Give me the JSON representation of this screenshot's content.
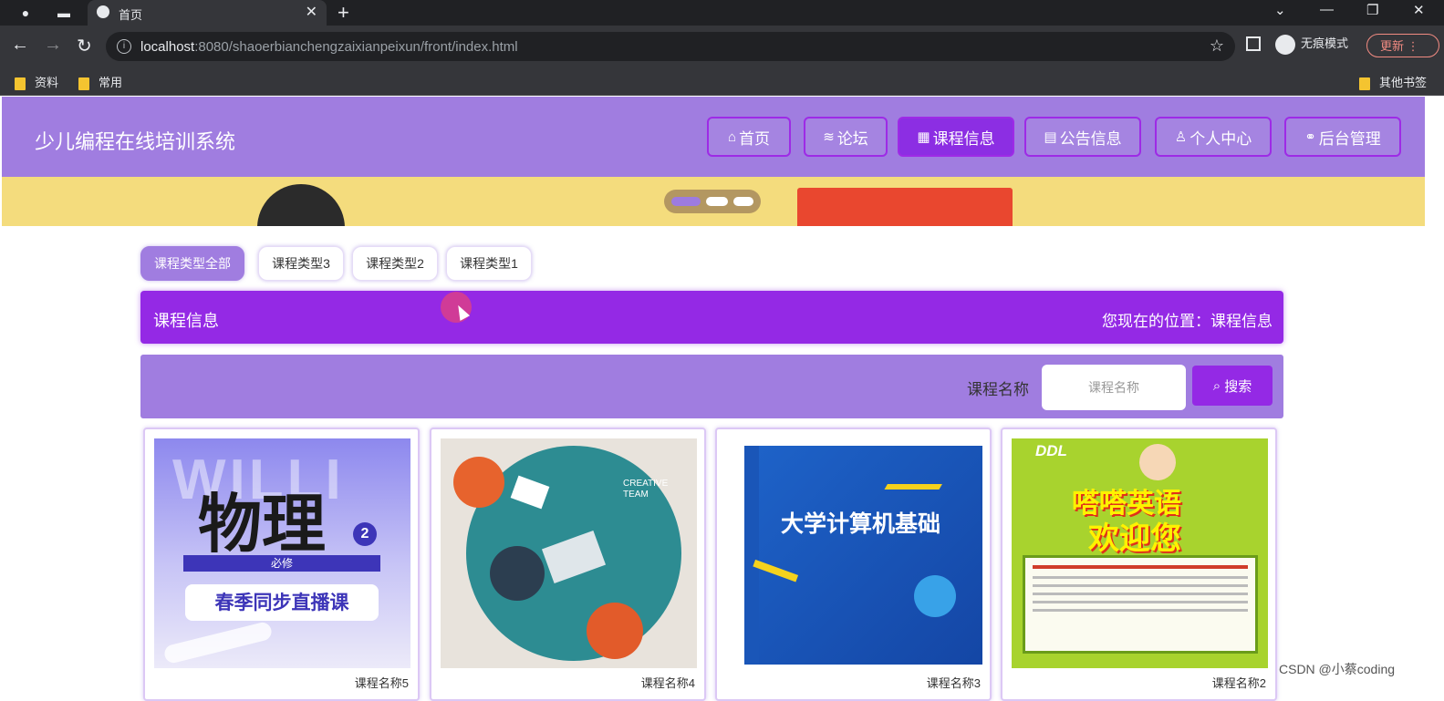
{
  "browser": {
    "tab_title": "首页",
    "url_host": "localhost",
    "url_rest": ":8080/shaoerbianchengzaixianpeixun/front/index.html",
    "incognito_label": "无痕模式",
    "update_label": "更新",
    "bookmarks": [
      "资料",
      "常用"
    ],
    "other_bookmarks": "其他书签"
  },
  "header": {
    "brand": "少儿编程在线培训系统",
    "nav": [
      {
        "label": "首页",
        "icon": "home-icon"
      },
      {
        "label": "论坛",
        "icon": "layers-icon"
      },
      {
        "label": "课程信息",
        "icon": "grid-icon"
      },
      {
        "label": "公告信息",
        "icon": "notice-icon"
      },
      {
        "label": "个人中心",
        "icon": "user-icon"
      },
      {
        "label": "后台管理",
        "icon": "link-icon"
      }
    ],
    "active_index": 2
  },
  "filters": [
    "课程类型全部",
    "课程类型3",
    "课程类型2",
    "课程类型1"
  ],
  "section": {
    "title": "课程信息",
    "location": "您现在的位置：课程信息"
  },
  "search": {
    "label": "课程名称",
    "placeholder": "课程名称",
    "button": "搜索"
  },
  "courses": [
    {
      "name": "课程名称5",
      "cover_title": "物理",
      "cover_badge": "2",
      "cover_sub": "必修",
      "cover_line": "春季同步直播课",
      "cover_bg": "WILLI"
    },
    {
      "name": "课程名称4",
      "cover_title": "CREATIVE TEAM"
    },
    {
      "name": "课程名称3",
      "cover_title": "大学计算机基础",
      "cover_spine": "大学计算机基础"
    },
    {
      "name": "课程名称2",
      "cover_title": "嗒嗒英语",
      "cover_sub": "欢迎您",
      "cover_logo": "DDL"
    }
  ],
  "watermark": "CSDN @小蔡coding",
  "colors": {
    "header": "#a07de0",
    "accent": "#9429e5",
    "banner": "#f4dc7d"
  }
}
